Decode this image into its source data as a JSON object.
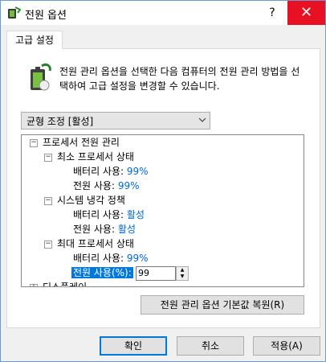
{
  "window": {
    "title": "전원 옵션",
    "help_glyph": "?",
    "close_glyph": "✕"
  },
  "tab": {
    "label": "고급 설정"
  },
  "intro": {
    "text": "전원 관리 옵션을 선택한 다음 컴퓨터의 전원 관리 방법을 선택하여 고급 설정을 변경할 수 있습니다."
  },
  "plan_select": {
    "value": "균형 조정 [활성]"
  },
  "tree": {
    "processor_group": "프로세서 전원 관리",
    "min_state": {
      "label": "최소 프로세서 상태",
      "battery_label": "배터리 사용:",
      "battery_value": "99%",
      "plugged_label": "전원 사용:",
      "plugged_value": "99%"
    },
    "cooling": {
      "label": "시스템 냉각 정책",
      "battery_label": "배터리 사용:",
      "battery_value": "활성",
      "plugged_label": "전원 사용:",
      "plugged_value": "활성"
    },
    "max_state": {
      "label": "최대 프로세서 상태",
      "battery_label": "배터리 사용:",
      "battery_value": "99%",
      "plugged_label": "전원 사용(%):",
      "plugged_input": "99"
    },
    "display_group": "디스플레이"
  },
  "buttons": {
    "restore": "전원 관리 옵션 기본값 복원(R)",
    "ok": "확인",
    "cancel": "취소",
    "apply": "적용(A)"
  },
  "colors": {
    "accent": "#0078d7",
    "value_text": "#0066cc",
    "close_red": "#e81123"
  }
}
